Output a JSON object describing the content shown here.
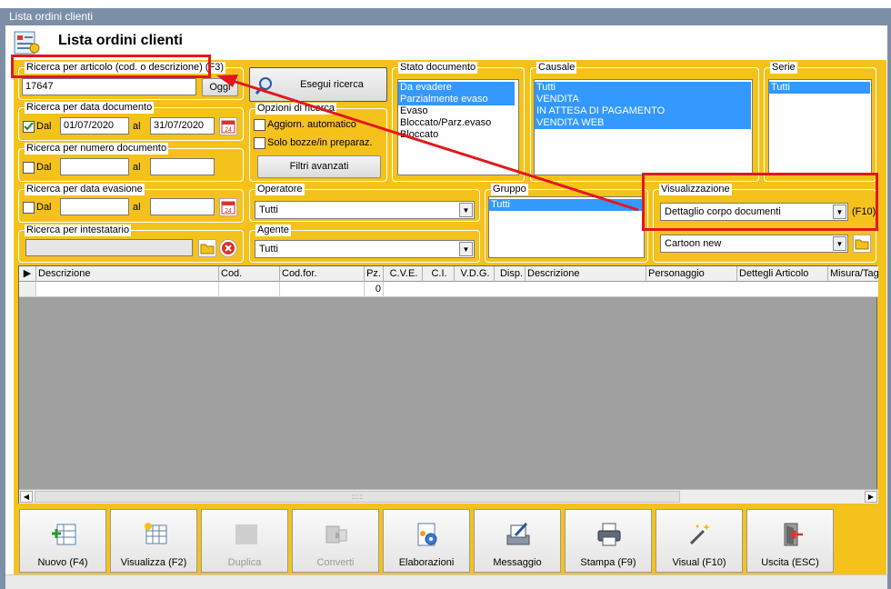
{
  "window": {
    "title": "Lista ordini clienti",
    "header_title": "Lista ordini clienti"
  },
  "search_article": {
    "legend": "Ricerca per articolo (cod. o descrizione) (F3)",
    "value": "17647",
    "today_btn": "Oggi"
  },
  "search_doc_date": {
    "legend": "Ricerca per data documento",
    "dal_label": "Dal",
    "from": "01/07/2020",
    "al_label": "al",
    "to": "31/07/2020"
  },
  "search_doc_num": {
    "legend": "Ricerca per numero documento",
    "dal_label": "Dal",
    "al_label": "al"
  },
  "search_evasion": {
    "legend": "Ricerca per data evasione",
    "dal_label": "Dal",
    "al_label": "al"
  },
  "search_holder": {
    "legend": "Ricerca per intestatario"
  },
  "run_search": {
    "label": "Esegui ricerca"
  },
  "search_options": {
    "legend": "Opzioni di ricerca",
    "auto": "Aggiorn. automatico",
    "drafts": "Solo bozze/in preparaz.",
    "advanced": "Filtri avanzati"
  },
  "stato": {
    "legend": "Stato documento",
    "items": [
      "Da evadere",
      "Parzialmente evaso",
      "Evaso",
      "Bloccato/Parz.evaso",
      "Bloccato"
    ]
  },
  "causale": {
    "legend": "Causale",
    "items": [
      "Tutti",
      "VENDITA",
      "IN ATTESA DI PAGAMENTO",
      "VENDITA WEB"
    ]
  },
  "serie": {
    "legend": "Serie",
    "items": [
      "Tutti"
    ]
  },
  "operatore": {
    "legend": "Operatore",
    "value": "Tutti"
  },
  "agente": {
    "legend": "Agente",
    "value": "Tutti"
  },
  "gruppo": {
    "legend": "Gruppo",
    "items": [
      "Tutti"
    ]
  },
  "visualizzazione": {
    "legend": "Visualizzazione",
    "value": "Dettaglio corpo documenti",
    "shortcut": "(F10)",
    "second": "Cartoon new"
  },
  "grid": {
    "headers": [
      "Descrizione",
      "Cod.",
      "Cod.for.",
      "Pz.",
      "C.V.E.",
      "C.I.",
      "V.D.G.",
      "Disp.",
      "Descrizione",
      "Personaggio",
      "Dettegli Articolo",
      "Misura/Tag"
    ],
    "row_pz": "0",
    "scroll_grip": "::::::"
  },
  "toolbar": [
    {
      "label": "Nuovo (F4)",
      "icon": "new-row-icon",
      "enabled": true
    },
    {
      "label": "Visualizza (F2)",
      "icon": "view-grid-icon",
      "enabled": true
    },
    {
      "label": "Duplica",
      "icon": "duplicate-icon",
      "enabled": false
    },
    {
      "label": "Converti",
      "icon": "convert-icon",
      "enabled": false
    },
    {
      "label": "Elaborazioni",
      "icon": "process-icon",
      "enabled": true
    },
    {
      "label": "Messaggio",
      "icon": "message-icon",
      "enabled": true
    },
    {
      "label": "Stampa (F9)",
      "icon": "printer-icon",
      "enabled": true
    },
    {
      "label": "Visual (F10)",
      "icon": "wand-icon",
      "enabled": true
    },
    {
      "label": "Uscita (ESC)",
      "icon": "exit-icon",
      "enabled": true
    }
  ],
  "colors": {
    "panel": "#f5c21b",
    "selection": "#3399ff",
    "annotation": "#e3171c",
    "titlebar": "#7d8fa6"
  }
}
